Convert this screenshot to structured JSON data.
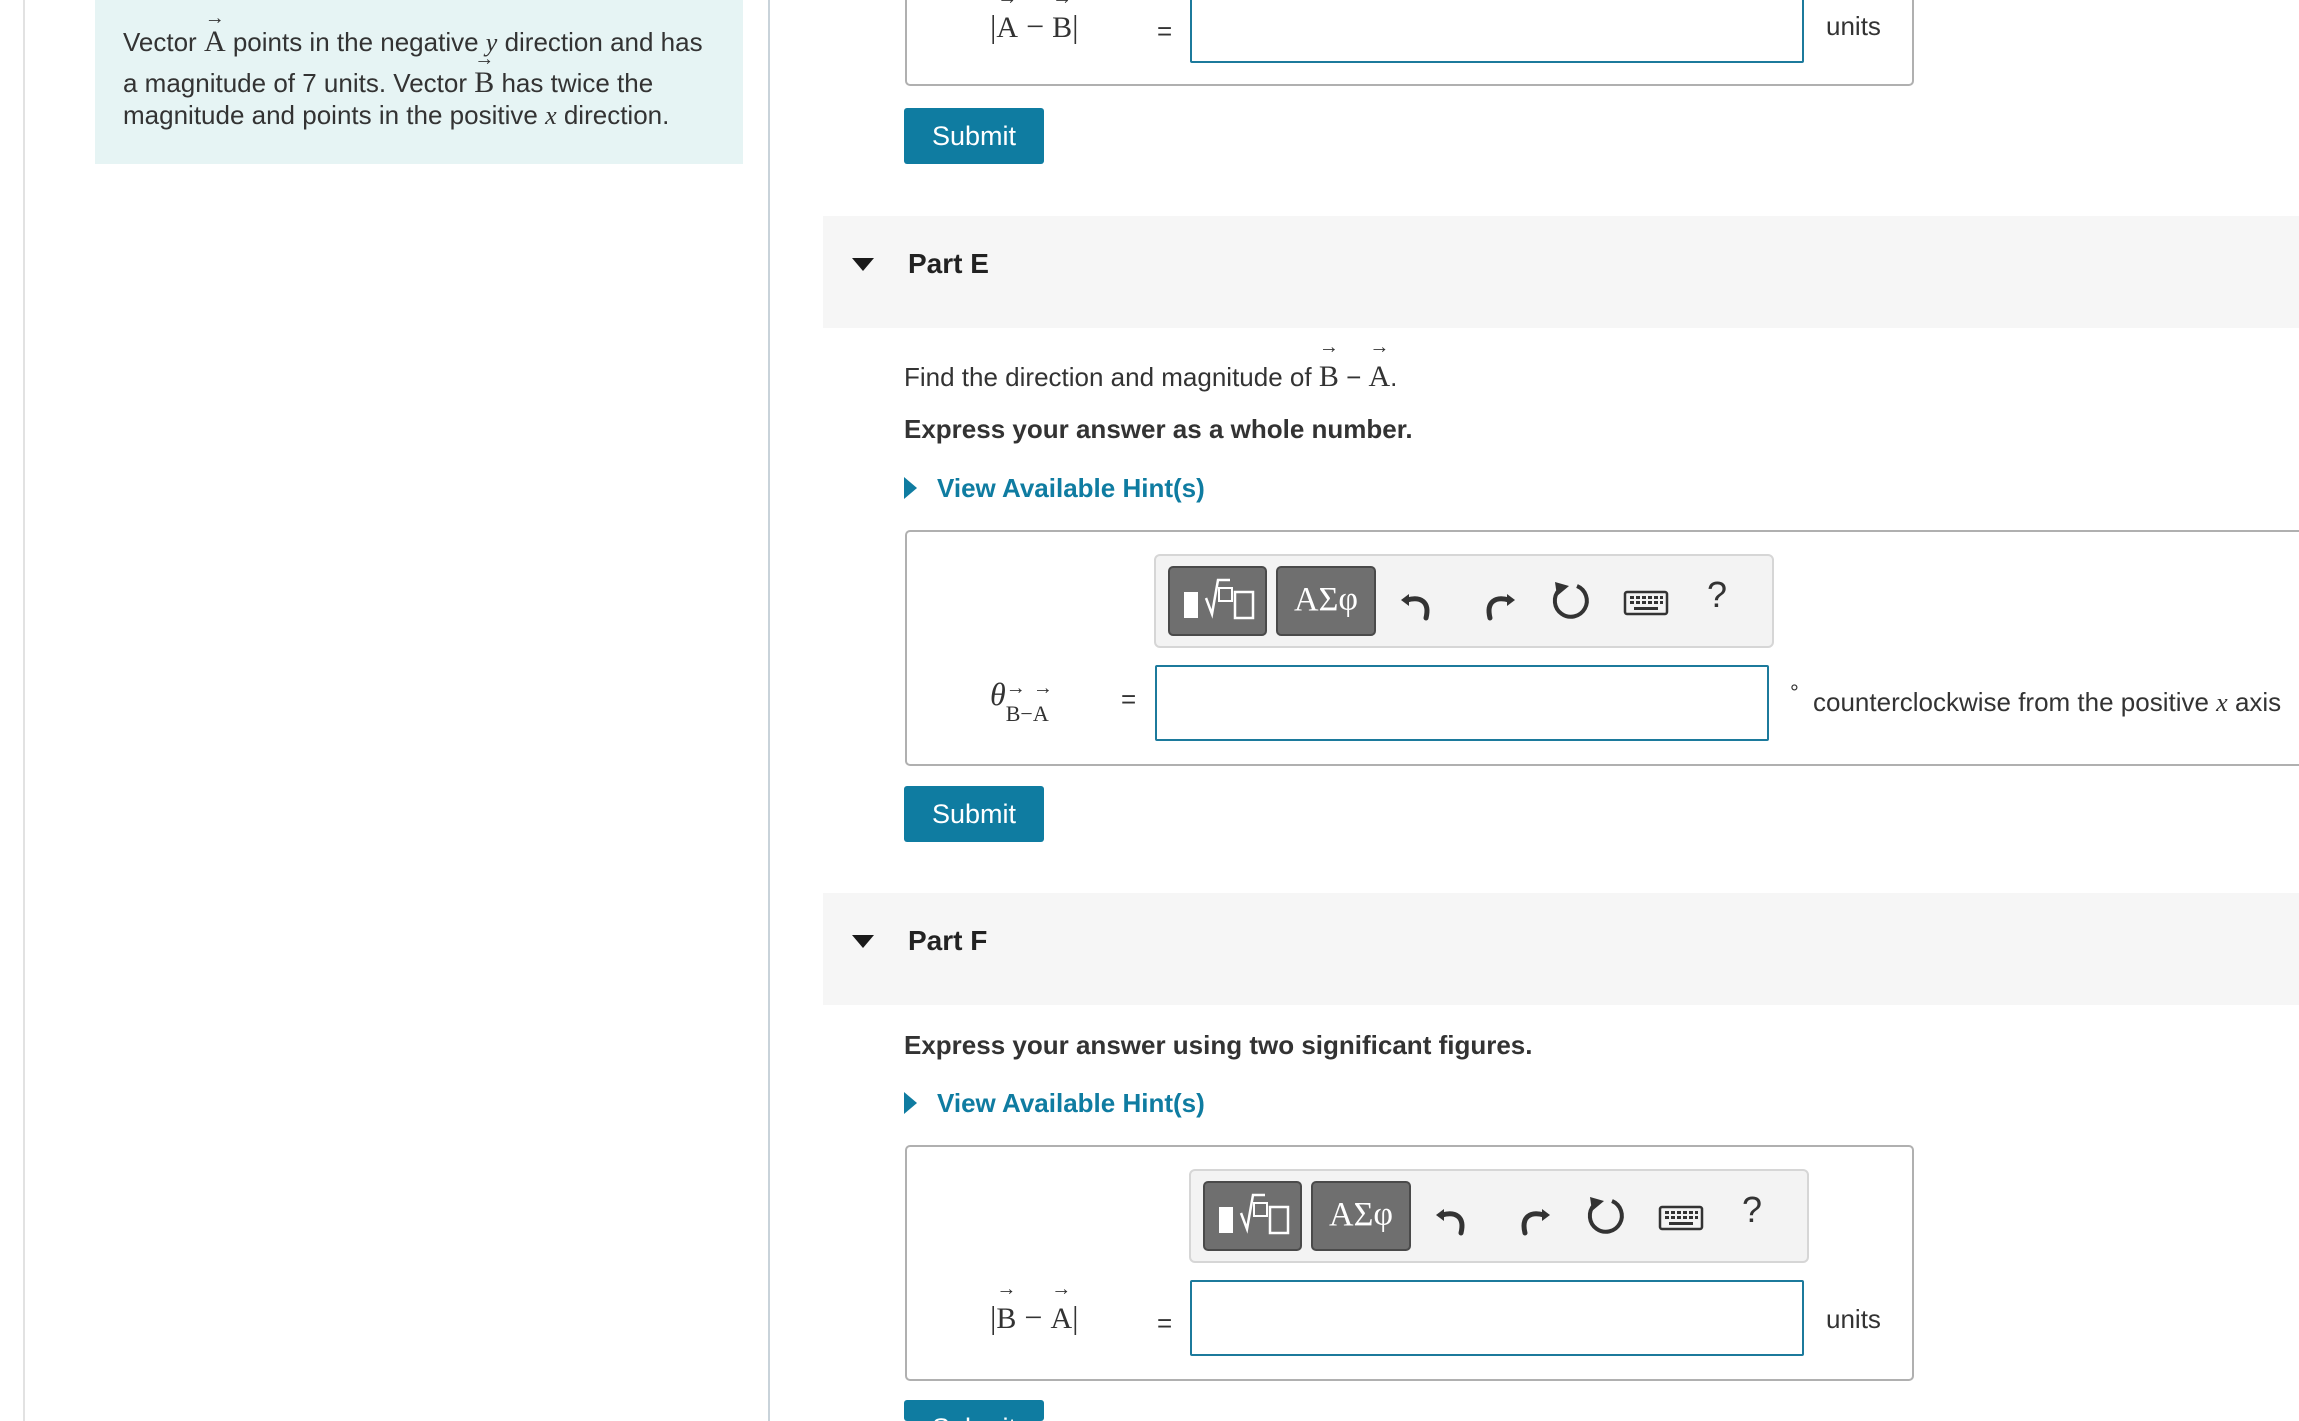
{
  "problem": {
    "t1": "Vector ",
    "vecA": "A",
    "t2": " points in the negative ",
    "y": "y",
    "t3": " direction and has",
    "t4": "a magnitude of 7 units. Vector ",
    "vecB": "B",
    "t5": " has twice the",
    "t6": "magnitude and points in the positive ",
    "x": "x",
    "t7": " direction."
  },
  "partD": {
    "lhs_open": "|",
    "lhs_a": "A",
    "lhs_minus": " − ",
    "lhs_b": "B",
    "lhs_close": "|",
    "equals": "=",
    "value": "",
    "unit": "units",
    "submit": "Submit"
  },
  "partE": {
    "title": "Part E",
    "prompt_pre": "Find the direction and magnitude of ",
    "prompt_b": "B",
    "prompt_minus": " − ",
    "prompt_a": "A",
    "prompt_end": ".",
    "instruction": "Express your answer as a whole number.",
    "hint": "View Available Hint(s)",
    "theta": "θ",
    "sub_b": "B",
    "sub_minus": "−",
    "sub_a": "A",
    "equals": "=",
    "value": "",
    "degree": "°",
    "unit_pre": "counterclockwise from the positive ",
    "unit_x": "x",
    "unit_post": " axis",
    "submit": "Submit"
  },
  "partF": {
    "title": "Part F",
    "instruction": "Express your answer using two significant figures.",
    "hint": "View Available Hint(s)",
    "lhs_open": "|",
    "lhs_b": "B",
    "lhs_minus": " − ",
    "lhs_a": "A",
    "lhs_close": "|",
    "equals": "=",
    "value": "",
    "unit": "units",
    "submit": "Submit"
  },
  "toolbar": {
    "greek_label": "ΑΣφ",
    "help_label": "?",
    "icons": [
      "templates-icon",
      "greek-symbols-icon",
      "undo-icon",
      "redo-icon",
      "reset-icon",
      "keyboard-icon",
      "help-icon"
    ]
  },
  "colors": {
    "accent": "#0f7ca1",
    "problem_bg": "#e6f4f4",
    "part_header_bg": "#f6f6f6",
    "input_border": "#1c7a9c"
  }
}
